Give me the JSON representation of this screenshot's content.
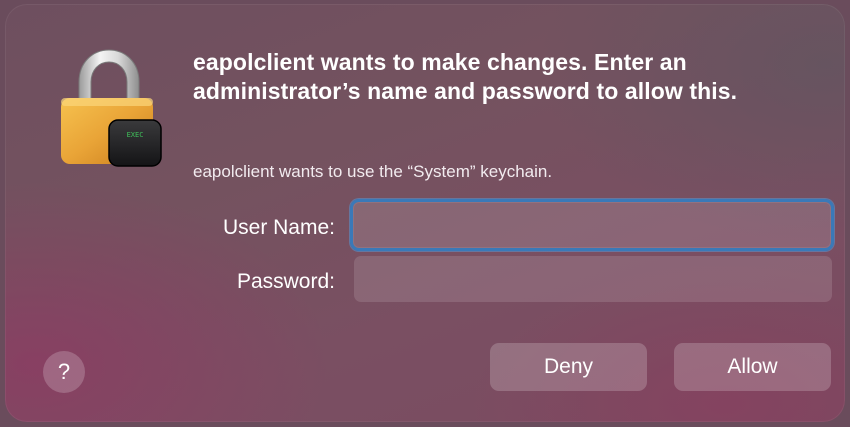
{
  "dialog": {
    "headline": "eapolclient wants to make changes. Enter an administrator’s name and password to allow this.",
    "subtext": "eapolclient wants to use the “System” keychain.",
    "lock_badge_text": "EXEC",
    "fields": {
      "username_label": "User Name:",
      "username_value": "",
      "password_label": "Password:",
      "password_value": ""
    },
    "buttons": {
      "help": "?",
      "deny": "Deny",
      "allow": "Allow"
    }
  },
  "colors": {
    "focus_ring": "#3a79b8",
    "lock_gold": "#e9a437",
    "badge_text": "#3fbf5a"
  },
  "icons": {
    "lock": "lock-icon",
    "terminal_badge": "terminal-badge-icon"
  }
}
